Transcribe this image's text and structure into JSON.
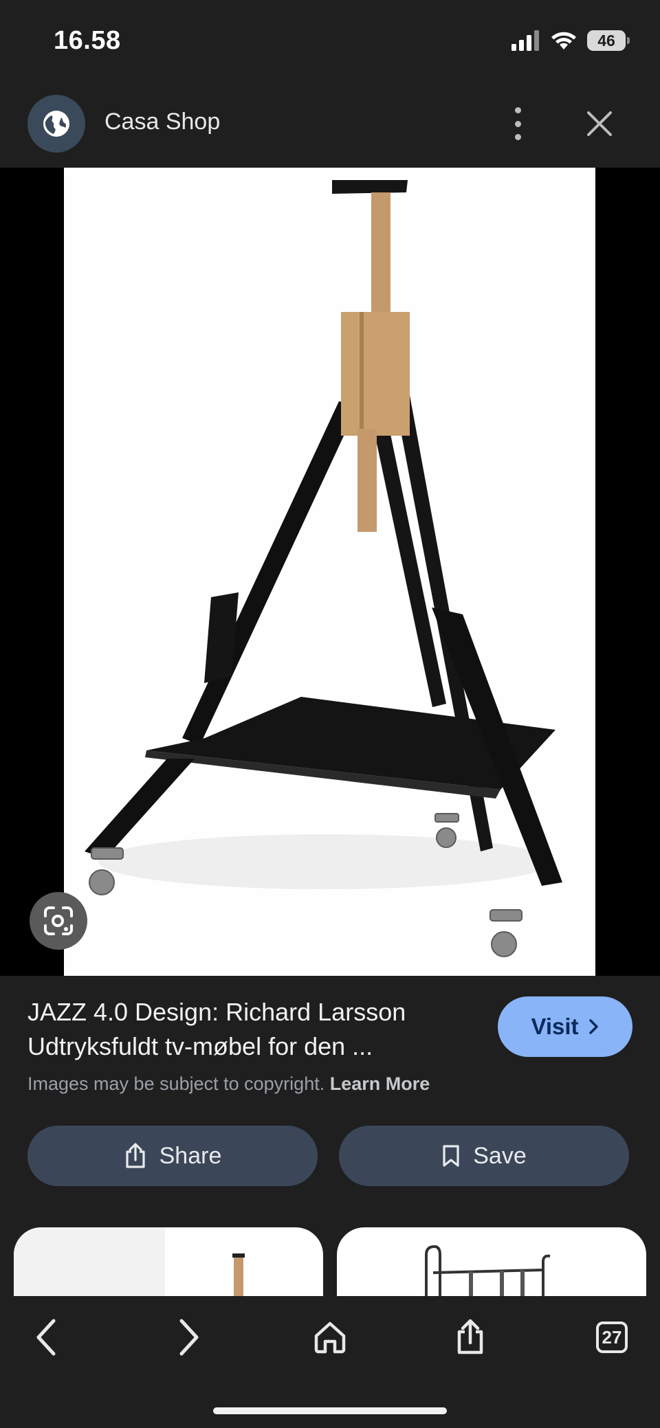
{
  "status_bar": {
    "time": "16.58",
    "battery_level": "46",
    "icons": [
      "cellular-signal-icon",
      "wifi-icon",
      "battery-icon"
    ]
  },
  "header": {
    "site_icon": "globe-icon",
    "site_name": "Casa Shop",
    "menu_icon": "more-vert-icon",
    "close_icon": "close-icon"
  },
  "main_image": {
    "lens_icon": "google-lens-icon"
  },
  "result": {
    "title_line1": "JAZZ 4.0 Design: Richard Larsson",
    "title_line2": "Udtryksfuldt tv-møbel for den ...",
    "visit_label": "Visit",
    "copyright_text": "Images may be subject to copyright.",
    "learn_more": "Learn More"
  },
  "actions": {
    "share_label": "Share",
    "save_label": "Save"
  },
  "bottom_nav": {
    "tab_count": "27",
    "items": [
      "back-icon",
      "forward-icon",
      "home-icon",
      "share-icon",
      "tabs-icon"
    ]
  },
  "colors": {
    "background": "#1f1f1f",
    "visit_button": "#8ab4f8",
    "pill_button": "#3b4758"
  }
}
